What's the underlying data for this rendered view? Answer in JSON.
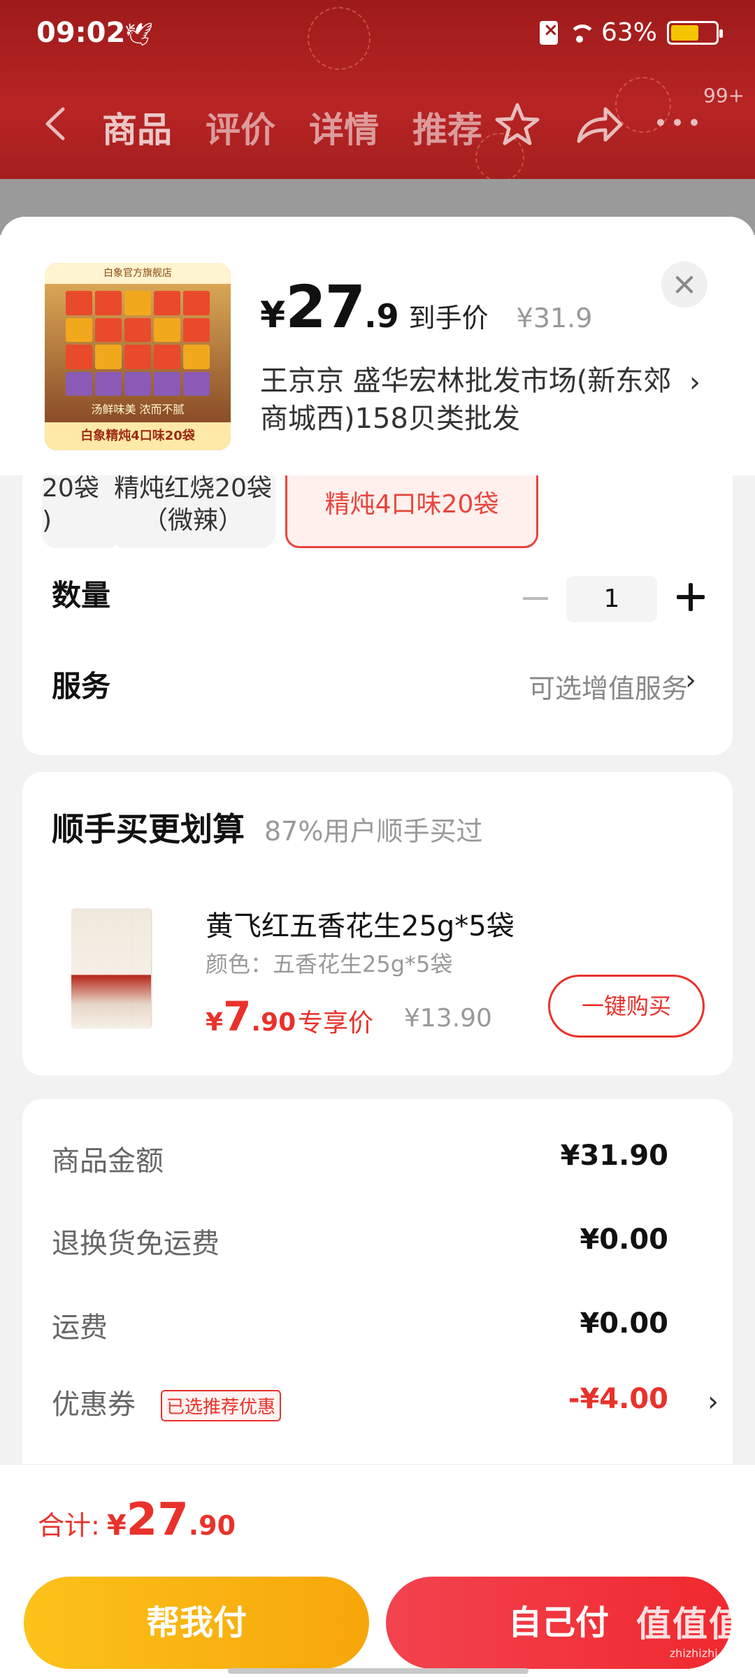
{
  "status_bar": {
    "time": "09:02",
    "battery": "63%",
    "battery_level": 0.63
  },
  "nav": {
    "tabs": [
      "商品",
      "评价",
      "详情",
      "推荐"
    ],
    "more_badge": "99+"
  },
  "sheet": {
    "price_yen": "¥",
    "price_int": "27",
    "price_dec": ".9",
    "price_label": "到手价",
    "original_price": "¥31.9",
    "address": "王京京  盛华宏林批发市场(新东郊商城西)158贝类批发",
    "thumb": {
      "store": "白象官方旗舰店",
      "slogan": "汤鲜味美 浓而不腻",
      "banner": "白象精炖4口味20袋"
    }
  },
  "options": {
    "specs": [
      {
        "label": "20袋\n)",
        "selected": false
      },
      {
        "label": "精炖红烧20袋\n（微辣）",
        "selected": false
      },
      {
        "label": "精炖4口味20袋",
        "selected": true
      }
    ],
    "quantity_label": "数量",
    "quantity_value": "1",
    "service_label": "服务",
    "service_value": "可选增值服务"
  },
  "upsell": {
    "title": "顺手买更划算",
    "subtitle": "87%用户顺手买过",
    "item_name": "黄飞红五香花生25g*5袋",
    "item_spec": "颜色：五香花生25g*5袋",
    "price_yen": "¥",
    "price_int": "7",
    "price_dec": ".90",
    "price_tag": "专享价",
    "original_price": "¥13.90",
    "buy_label": "一键购买"
  },
  "summary": {
    "rows": [
      {
        "label": "商品金额",
        "value": "¥31.90"
      },
      {
        "label": "退换货免运费",
        "value": "¥0.00"
      },
      {
        "label": "运费",
        "value": "¥0.00"
      },
      {
        "label": "优惠券",
        "value": "-¥4.00",
        "tag": "已选推荐优惠"
      }
    ]
  },
  "bottom": {
    "total_label": "合计:",
    "total_yen": "¥",
    "total_int": "27",
    "total_dec": ".90",
    "help_pay": "帮我付",
    "self_pay": "自己付"
  },
  "watermark": {
    "big": "值值值",
    "small": "zhizhizhi.com"
  },
  "colors": {
    "accent": "#e8322b",
    "header": "#a51f1f",
    "help_pay": "#f7a60a",
    "self_pay": "#f0292f"
  }
}
